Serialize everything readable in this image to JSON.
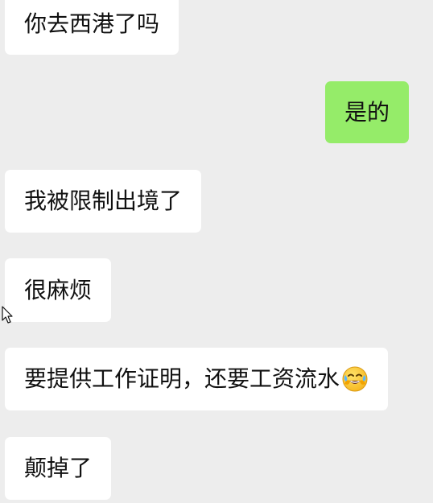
{
  "messages": [
    {
      "direction": "incoming",
      "text": "你去西港了吗"
    },
    {
      "direction": "outgoing",
      "text": "是的"
    },
    {
      "direction": "incoming",
      "text": "我被限制出境了"
    },
    {
      "direction": "incoming",
      "text": "很麻烦"
    },
    {
      "direction": "incoming",
      "text": "要提供工作证明，还要工资流水",
      "emoji": "laughing-crying-face-icon"
    },
    {
      "direction": "incoming",
      "text": "颠掉了"
    }
  ],
  "colors": {
    "background": "#ededed",
    "incoming_bubble": "#ffffff",
    "outgoing_bubble": "#95ec69",
    "text": "#111111"
  }
}
